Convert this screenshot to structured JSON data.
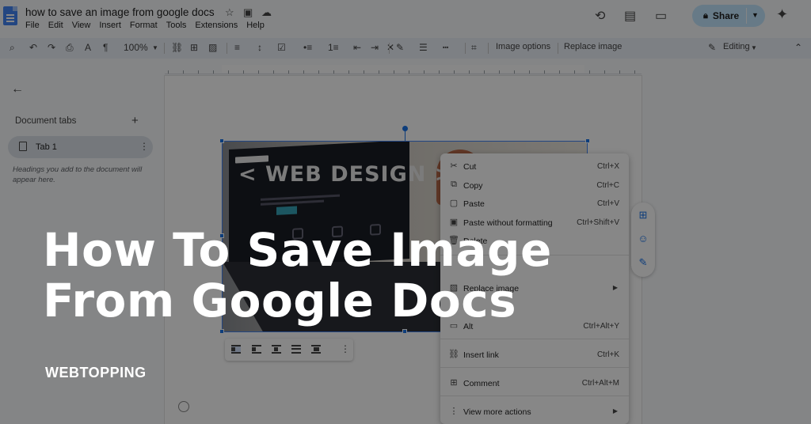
{
  "document": {
    "title": "how to save an image from google docs",
    "menu": [
      "File",
      "Edit",
      "View",
      "Insert",
      "Format",
      "Tools",
      "Extensions",
      "Help"
    ]
  },
  "header": {
    "share_label": "Share"
  },
  "toolbar": {
    "zoom": "100%",
    "image_options": "Image options",
    "replace_image": "Replace image",
    "mode": "Editing"
  },
  "left_panel": {
    "heading": "Document tabs",
    "tab_label": "Tab 1",
    "hint": "Headings you add to the document will appear here."
  },
  "image": {
    "screen_text": "< WEB DESIGN >"
  },
  "context_menu": {
    "items": [
      {
        "label": "Cut",
        "shortcut": "Ctrl+X",
        "icon": "scissors-icon"
      },
      {
        "label": "Copy",
        "shortcut": "Ctrl+C",
        "icon": "copy-icon"
      },
      {
        "label": "Paste",
        "shortcut": "Ctrl+V",
        "icon": "clipboard-icon"
      },
      {
        "label": "Paste without formatting",
        "shortcut": "Ctrl+Shift+V",
        "icon": "clipboard-plain-icon"
      },
      {
        "label": "Delete",
        "shortcut": "",
        "icon": "trash-icon"
      },
      {
        "label": "Replace image",
        "shortcut": "",
        "icon": "image-icon"
      },
      {
        "label": "Alt",
        "shortcut": "Ctrl+Alt+Y",
        "icon": "alt-text-icon"
      },
      {
        "label": "Insert link",
        "shortcut": "Ctrl+K",
        "icon": "link-icon"
      },
      {
        "label": "Comment",
        "shortcut": "Ctrl+Alt+M",
        "icon": "comment-add-icon"
      },
      {
        "label": "View more actions",
        "shortcut": "",
        "icon": "more-vert-icon"
      }
    ]
  },
  "overlay": {
    "headline_line1": "How To Save Image",
    "headline_line2": "From Google Docs",
    "brand": "WEBTOPPING"
  }
}
